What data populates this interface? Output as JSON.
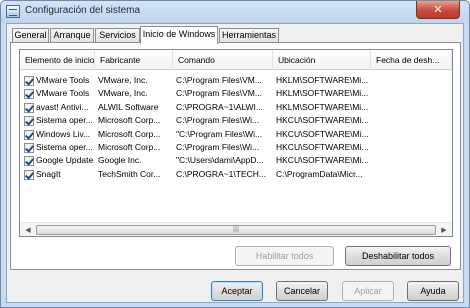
{
  "window": {
    "title": "Configuración del sistema",
    "close_glyph": "✕"
  },
  "tabs": [
    {
      "label": "General"
    },
    {
      "label": "Arranque"
    },
    {
      "label": "Servicios"
    },
    {
      "label": "Inicio de Windows",
      "active": true
    },
    {
      "label": "Herramientas"
    }
  ],
  "table": {
    "columns": [
      "Elemento de inicio",
      "Fabricante",
      "Comando",
      "Ubicación",
      "Fecha de desh..."
    ],
    "rows": [
      {
        "checked": true,
        "cells": [
          "VMware Tools",
          "VMware, Inc.",
          "C:\\Program Files\\VM...",
          "HKLM\\SOFTWARE\\Mi...",
          ""
        ]
      },
      {
        "checked": true,
        "cells": [
          "VMware Tools",
          "VMware, Inc.",
          "C:\\Program Files\\VM...",
          "HKLM\\SOFTWARE\\Mi...",
          ""
        ]
      },
      {
        "checked": true,
        "cells": [
          "avast! Antivi...",
          "ALWIL Software",
          "C:\\PROGRA~1\\ALWI...",
          "HKLM\\SOFTWARE\\Mi...",
          ""
        ]
      },
      {
        "checked": true,
        "cells": [
          "Sistema oper...",
          "Microsoft Corp...",
          "C:\\Program Files\\Wi...",
          "HKCU\\SOFTWARE\\Mi...",
          ""
        ]
      },
      {
        "checked": true,
        "cells": [
          "Windows Liv...",
          "Microsoft Corp...",
          "\"C:\\Program Files\\Wi...",
          "HKCU\\SOFTWARE\\Mi...",
          ""
        ]
      },
      {
        "checked": true,
        "cells": [
          "Sistema oper...",
          "Microsoft Corp...",
          "C:\\Program Files\\Wi...",
          "HKCU\\SOFTWARE\\Mi...",
          ""
        ]
      },
      {
        "checked": true,
        "cells": [
          "Google Update",
          "Google Inc.",
          "\"C:\\Users\\dami\\AppD...",
          "HKCU\\SOFTWARE\\Mi...",
          ""
        ]
      },
      {
        "checked": true,
        "cells": [
          "SnagIt",
          "TechSmith Cor...",
          "C:\\PROGRA~1\\TECH...",
          "C:\\ProgramData\\Micr...",
          ""
        ]
      }
    ],
    "scrollbar": {
      "left_arrow": "◀",
      "right_arrow": "▶",
      "grip": "|||"
    }
  },
  "buttons": {
    "enable_all": "Habilitar todos",
    "disable_all": "Deshabilitar todos",
    "ok": "Aceptar",
    "cancel": "Cancelar",
    "apply": "Aplicar",
    "help": "Ayuda"
  }
}
